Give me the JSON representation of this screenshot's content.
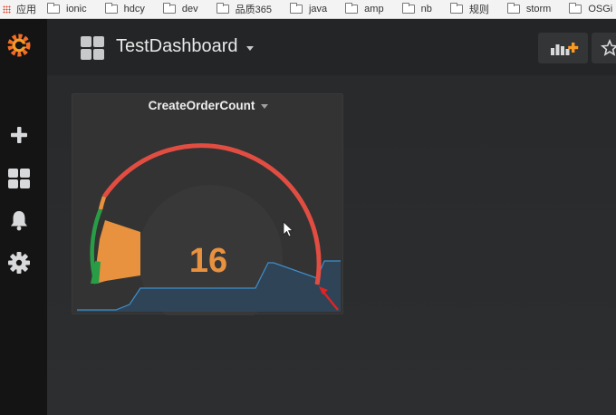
{
  "bookmarks": {
    "apps_label": "应用",
    "items": [
      "ionic",
      "hdcy",
      "dev",
      "品质365",
      "java",
      "amp",
      "nb",
      "规则",
      "storm",
      "OSGi"
    ]
  },
  "sidebar": {
    "items": [
      "grafana-logo",
      "plus-icon",
      "dashboards-icon",
      "bell-icon",
      "gear-icon"
    ]
  },
  "navbar": {
    "dashboard_title": "TestDashboard"
  },
  "panel": {
    "title": "CreateOrderCount",
    "value": "16",
    "value_color": "#e8913e",
    "gauge": {
      "threshold_colors": [
        "#299c46",
        "#e8913e",
        "#e24d42"
      ],
      "sparkline_color": "#3e8fcc"
    }
  },
  "colors": {
    "background": "#161719",
    "panel_bg": "#333333",
    "text": "#d8d9da"
  }
}
